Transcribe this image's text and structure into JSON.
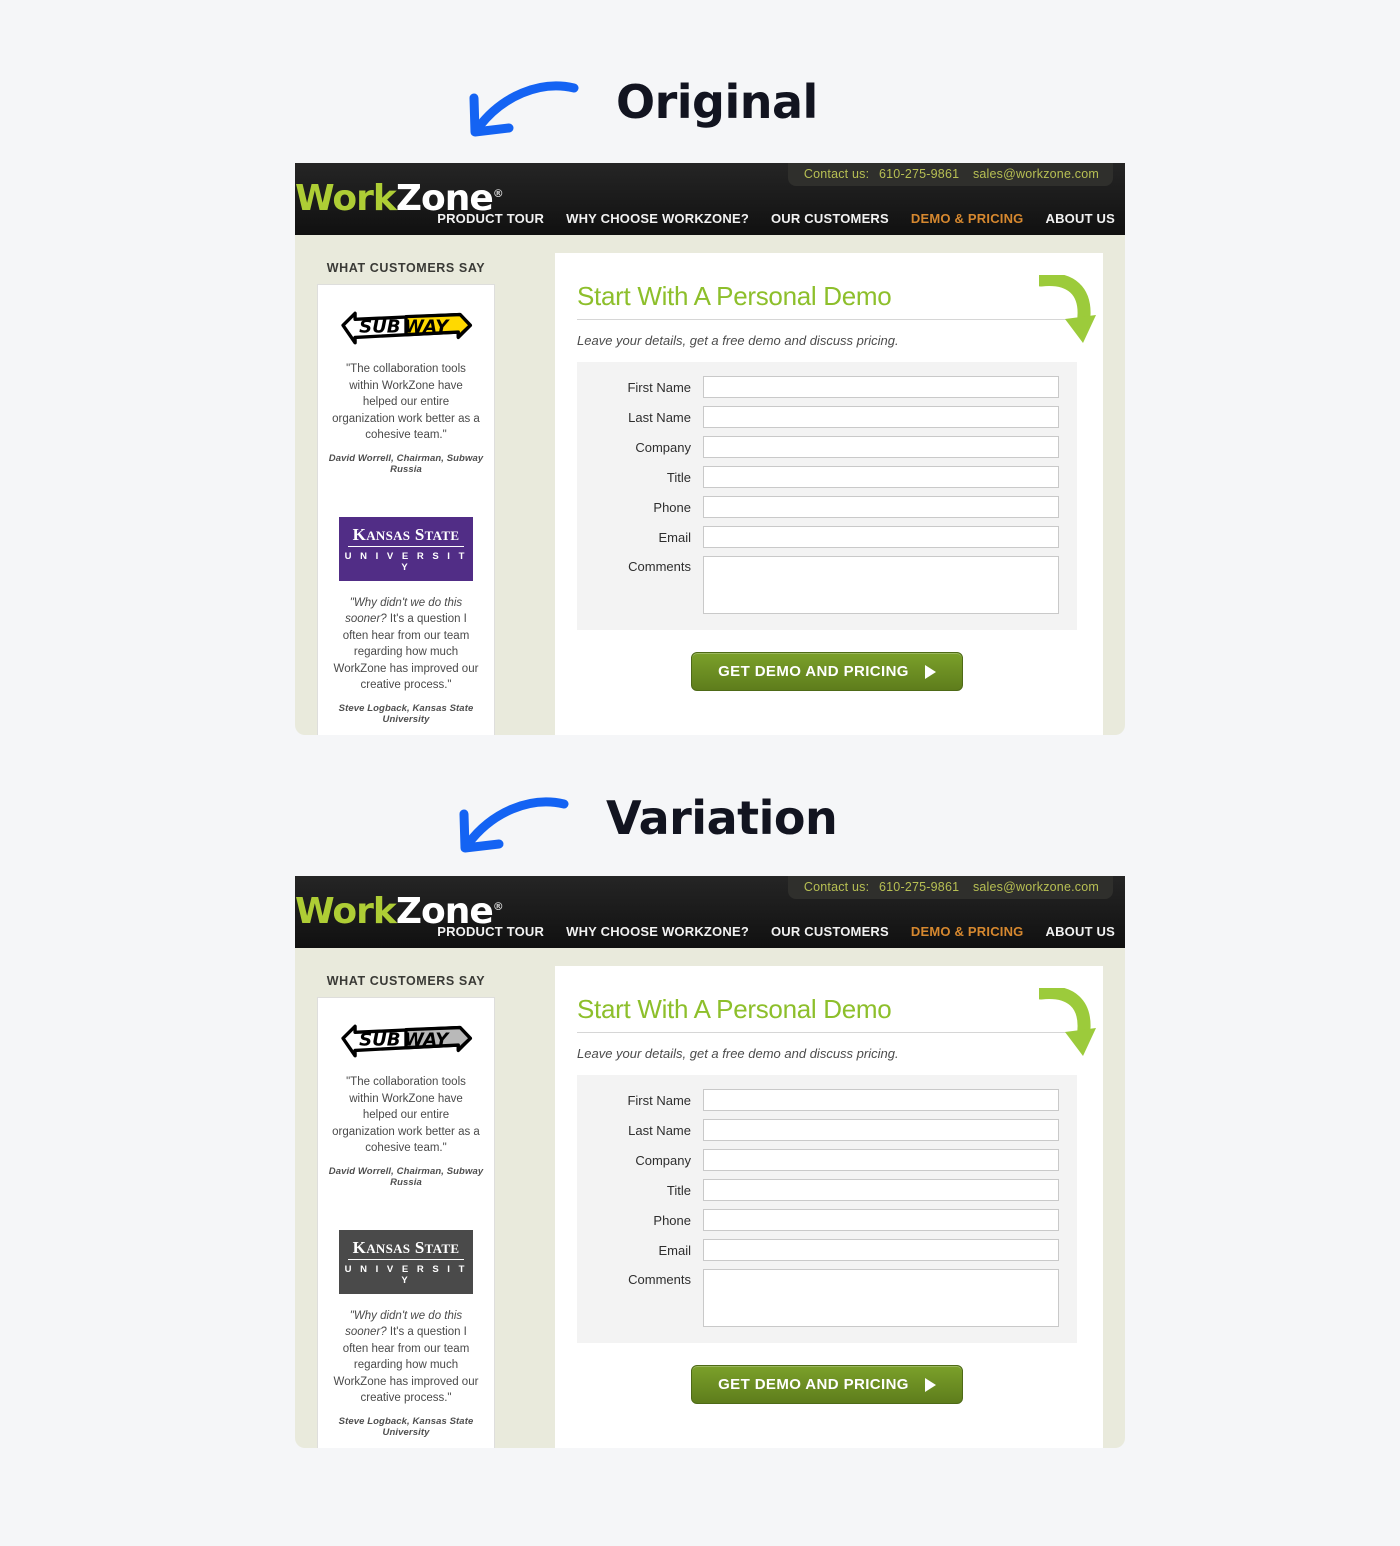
{
  "annotations": [
    {
      "label": "Original",
      "arrow_color": "#1463f3"
    },
    {
      "label": "Variation",
      "arrow_color": "#1463f3"
    }
  ],
  "site": {
    "logo": {
      "part1": "Work",
      "part2": "Zone",
      "registered": "®"
    },
    "contact": {
      "label": "Contact us:",
      "phone": "610-275-9861",
      "email": "sales@workzone.com"
    },
    "nav": [
      {
        "label": "PRODUCT TOUR",
        "active": false
      },
      {
        "label": "WHY CHOOSE WORKZONE?",
        "active": false
      },
      {
        "label": "OUR CUSTOMERS",
        "active": false
      },
      {
        "label": "DEMO & PRICING",
        "active": true
      },
      {
        "label": "ABOUT US",
        "active": false
      }
    ],
    "sidebar": {
      "heading": "WHAT CUSTOMERS SAY",
      "testimonials": [
        {
          "logo_name": "subway-logo",
          "logo_text": "SUBWAY",
          "quote": "\"The collaboration tools within WorkZone have helped our entire organization work better as a cohesive team.\"",
          "attribution": "David Worrell, Chairman, Subway Russia"
        },
        {
          "logo_name": "kansas-state-university-logo",
          "logo_line1": "K",
          "logo_line1_rest": "ANSAS ",
          "logo_line1_b": "S",
          "logo_line1_rest2": "TATE",
          "logo_line2": "U N I V E R S I T Y",
          "quote_italic": "\"Why didn't we do this sooner?",
          "quote_rest": " It's a question I often hear from our team regarding how much WorkZone has improved our creative process.\"",
          "attribution": "Steve Logback, Kansas State University"
        }
      ]
    },
    "form": {
      "title": "Start With A Personal Demo",
      "subtitle": "Leave your details, get a free demo and discuss pricing.",
      "fields": [
        {
          "label": "First Name",
          "value": "",
          "type": "text"
        },
        {
          "label": "Last Name",
          "value": "",
          "type": "text"
        },
        {
          "label": "Company",
          "value": "",
          "type": "text"
        },
        {
          "label": "Title",
          "value": "",
          "type": "text"
        },
        {
          "label": "Phone",
          "value": "",
          "type": "text"
        },
        {
          "label": "Email",
          "value": "",
          "type": "text"
        },
        {
          "label": "Comments",
          "value": "",
          "type": "textarea"
        }
      ],
      "submit_label": "GET DEMO AND PRICING"
    }
  },
  "variants": {
    "original": {
      "subway_style": "color",
      "ksu_style": "color"
    },
    "variation": {
      "subway_style": "gray",
      "ksu_style": "gray"
    }
  },
  "colors": {
    "page_background": "#f5f6f8",
    "panel_background": "#e9eadc",
    "header_background": "#1d1d1d",
    "brand_green": "#aecd35",
    "nav_active": "#d6882f",
    "contact_text": "#b7bf53",
    "title_green": "#8dbf2b",
    "button_green": "#6d9123",
    "annotation_blue": "#1463f3",
    "ksu_purple": "#512d86",
    "ksu_gray": "#4a4a4a"
  }
}
